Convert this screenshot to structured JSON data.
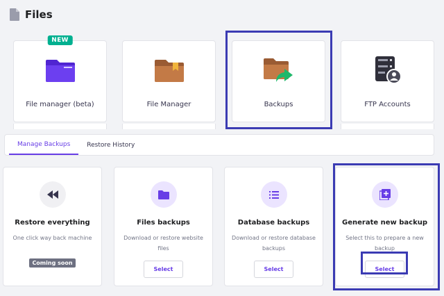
{
  "header": {
    "title": "Files",
    "icon": "document-icon"
  },
  "tiles": [
    {
      "label": "File manager (beta)",
      "icon": "purple-folder-icon",
      "badge": "NEW"
    },
    {
      "label": "File Manager",
      "icon": "brown-folder-icon"
    },
    {
      "label": "Backups",
      "icon": "backup-folder-icon"
    },
    {
      "label": "FTP Accounts",
      "icon": "ftp-server-icon"
    }
  ],
  "tabs": [
    {
      "label": "Manage Backups",
      "active": true
    },
    {
      "label": "Restore History",
      "active": false
    }
  ],
  "cards": [
    {
      "title": "Restore everything",
      "desc": "One click way back machine",
      "badge": "Coming soon",
      "icon": "rewind-icon"
    },
    {
      "title": "Files backups",
      "desc": "Download or restore website files",
      "button": "Select",
      "icon": "folder-icon"
    },
    {
      "title": "Database backups",
      "desc": "Download or restore database backups",
      "button": "Select",
      "icon": "list-icon"
    },
    {
      "title": "Generate new backup",
      "desc": "Select this to prepare a new backup",
      "button": "Select",
      "icon": "add-box-icon"
    }
  ],
  "colors": {
    "accent": "#673de6",
    "highlight": "#3b3bb3",
    "new_badge": "#00b090"
  }
}
